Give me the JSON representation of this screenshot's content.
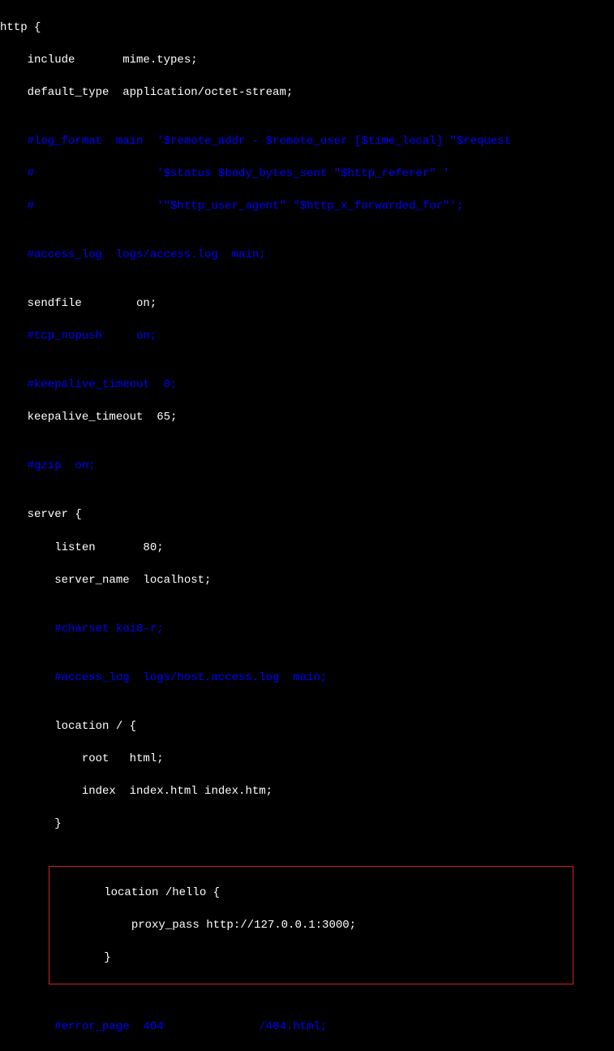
{
  "lines": {
    "l1": "http {",
    "l2": "    include       mime.types;",
    "l3": "    default_type  application/octet-stream;",
    "l4": "",
    "l5": "    #log_format  main  '$remote_addr - $remote_user [$time_local] \"$request",
    "l6": "    #                  '$status $body_bytes_sent \"$http_referer\" '",
    "l7": "    #                  '\"$http_user_agent\" \"$http_x_forwarded_for\"';",
    "l8": "",
    "l9": "    #access_log  logs/access.log  main;",
    "l10": "",
    "l11": "    sendfile        on;",
    "l12": "    #tcp_nopush     on;",
    "l13": "",
    "l14": "    #keepalive_timeout  0;",
    "l15": "    keepalive_timeout  65;",
    "l16": "",
    "l17": "    #gzip  on;",
    "l18": "",
    "l19": "    server {",
    "l20": "        listen       80;",
    "l21": "        server_name  localhost;",
    "l22": "",
    "l23": "        #charset koi8-r;",
    "l24": "",
    "l25": "        #access_log  logs/host.access.log  main;",
    "l26": "",
    "l27": "        location / {",
    "l28": "            root   html;",
    "l29": "            index  index.html index.htm;",
    "l30": "        }",
    "l31": "",
    "l32": "        location /hello {",
    "l33": "            proxy_pass http://127.0.0.1:3000;",
    "l34": "        }",
    "l35": "",
    "l36": "        #error_page  404              /404.html;"
  }
}
